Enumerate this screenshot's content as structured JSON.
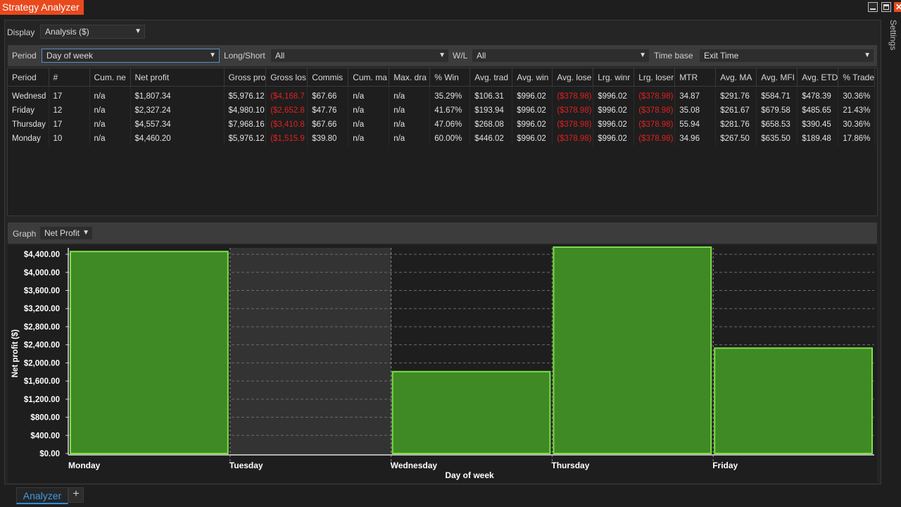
{
  "window": {
    "title": "Strategy Analyzer",
    "side_tab": "Settings"
  },
  "display": {
    "label": "Display",
    "value": "Analysis ($)"
  },
  "filters": {
    "period_label": "Period",
    "period_value": "Day of week",
    "longshort_label": "Long/Short",
    "longshort_value": "All",
    "wl_label": "W/L",
    "wl_value": "All",
    "timebase_label": "Time base",
    "timebase_value": "Exit Time"
  },
  "table": {
    "columns": [
      "Period",
      "#",
      "Cum. ne",
      "Net profit",
      "Gross pro",
      "Gross los",
      "Commis",
      "Cum. ma",
      "Max. dra",
      "% Win",
      "Avg. trad",
      "Avg. win",
      "Avg. lose",
      "Lrg. winr",
      "Lrg. loser",
      "MTR",
      "Avg. MA",
      "Avg. MFI",
      "Avg. ETD",
      "% Trade"
    ],
    "rows": [
      [
        "Wednesd",
        "17",
        "n/a",
        "$1,807.34",
        "$5,976.12",
        "($4,168.7",
        "$67.66",
        "n/a",
        "n/a",
        "35.29%",
        "$106.31",
        "$996.02",
        "($378.98)",
        "$996.02",
        "($378.98)",
        "34.87",
        "$291.76",
        "$584.71",
        "$478.39",
        "30.36%"
      ],
      [
        "Friday",
        "12",
        "n/a",
        "$2,327.24",
        "$4,980.10",
        "($2,652.8",
        "$47.76",
        "n/a",
        "n/a",
        "41.67%",
        "$193.94",
        "$996.02",
        "($378.98)",
        "$996.02",
        "($378.98)",
        "35.08",
        "$261.67",
        "$679.58",
        "$485.65",
        "21.43%"
      ],
      [
        "Thursday",
        "17",
        "n/a",
        "$4,557.34",
        "$7,968.16",
        "($3,410.8",
        "$67.66",
        "n/a",
        "n/a",
        "47.06%",
        "$268.08",
        "$996.02",
        "($378.98)",
        "$996.02",
        "($378.98)",
        "55.94",
        "$281.76",
        "$658.53",
        "$390.45",
        "30.36%"
      ],
      [
        "Monday",
        "10",
        "n/a",
        "$4,460.20",
        "$5,976.12",
        "($1,515.9",
        "$39.80",
        "n/a",
        "n/a",
        "60.00%",
        "$446.02",
        "$996.02",
        "($378.98)",
        "$996.02",
        "($378.98)",
        "34.96",
        "$267.50",
        "$635.50",
        "$189.48",
        "17.86%"
      ]
    ]
  },
  "graph": {
    "label": "Graph",
    "value": "Net Profit"
  },
  "chart_data": {
    "type": "bar",
    "categories": [
      "Monday",
      "Tuesday",
      "Wednesday",
      "Thursday",
      "Friday"
    ],
    "values": [
      4460.2,
      0,
      1807.34,
      4557.34,
      2327.24
    ],
    "xlabel": "Day of week",
    "ylabel": "Net profit ($)",
    "ylim": [
      0,
      4500
    ],
    "yticks": [
      "$0.00",
      "$400.00",
      "$800.00",
      "$1,200.00",
      "$1,600.00",
      "$2,000.00",
      "$2,400.00",
      "$2,800.00",
      "$3,200.00",
      "$3,600.00",
      "$4,000.00",
      "$4,400.00"
    ],
    "grid": true,
    "highlighted_category": "Tuesday",
    "bar_color": "#3f8a24",
    "bar_border_color": "#7ee04a"
  },
  "tabs": {
    "active": "Analyzer",
    "add": "+"
  },
  "colors": {
    "accent": "#e8491d",
    "negative": "#e02020",
    "tab_active": "#3d9be6"
  }
}
